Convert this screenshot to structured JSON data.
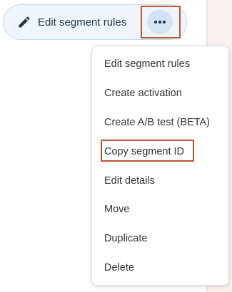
{
  "toolbar": {
    "edit_label": "Edit segment rules",
    "edit_icon": "pencil-icon",
    "more_icon": "more-horizontal-icon"
  },
  "menu": {
    "items": [
      {
        "label": "Edit segment rules"
      },
      {
        "label": "Create activation"
      },
      {
        "label": "Create A/B test (BETA)"
      },
      {
        "label": "Copy segment ID"
      },
      {
        "label": "Edit details"
      },
      {
        "label": "Move"
      },
      {
        "label": "Duplicate"
      },
      {
        "label": "Delete"
      }
    ]
  },
  "highlights": {
    "color": "#c0552f",
    "targets": [
      "more-options-button",
      "menu-item-copy-segment-id"
    ]
  },
  "colors": {
    "pill_background": "#eef5fc",
    "pill_border": "#c4d8ee",
    "more_button_background": "#d4e2f2",
    "text_dark": "#24364d",
    "menu_text": "#2f3338"
  }
}
